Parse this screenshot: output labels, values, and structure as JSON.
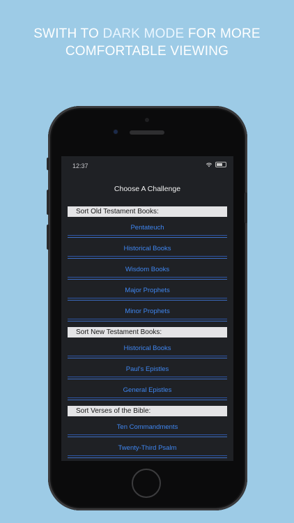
{
  "headline": {
    "part1": "SWITH TO ",
    "highlight": "DARK MODE",
    "part2": " FOR MORE",
    "line2": "COMFORTABLE VIEWING"
  },
  "status_bar": {
    "time": "12:37"
  },
  "screen_title": "Choose A Challenge",
  "sections": [
    {
      "header": "Sort Old Testament Books:",
      "items": [
        "Pentateuch",
        "Historical Books",
        "Wisdom Books",
        "Major Prophets",
        "Minor Prophets"
      ]
    },
    {
      "header": "Sort New Testament Books:",
      "items": [
        "Historical Books",
        "Paul's Epistles",
        "General Epistles"
      ]
    },
    {
      "header": "Sort Verses of the Bible:",
      "items": [
        "Ten Commandments",
        "Twenty-Third Psalm"
      ]
    }
  ],
  "colors": {
    "background": "#9dcbe6",
    "screen": "#1f2125",
    "link": "#3f86f0",
    "section_header_bg": "#e4e4e6"
  }
}
